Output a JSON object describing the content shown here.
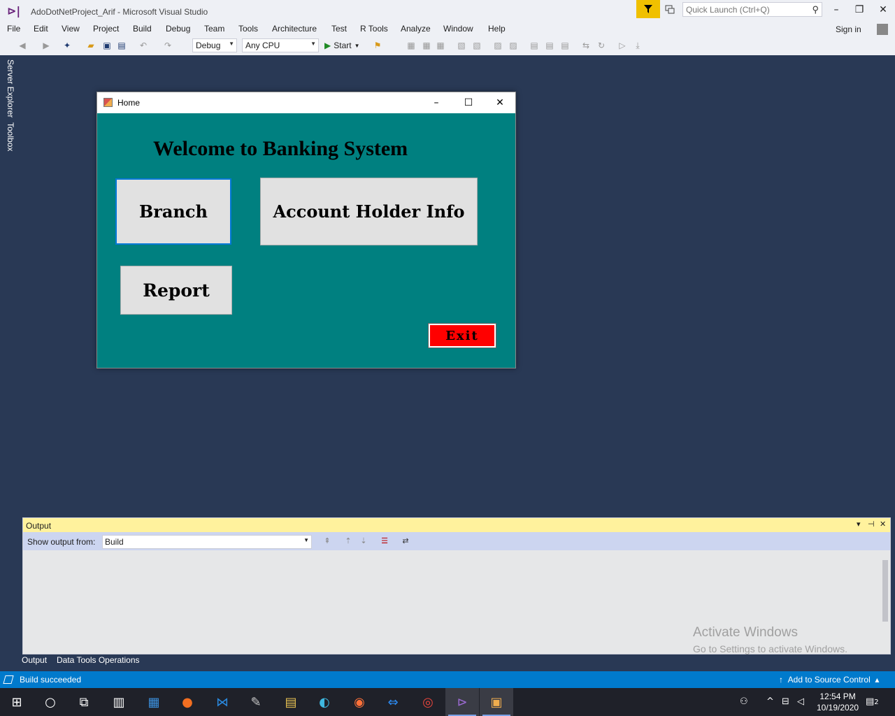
{
  "window": {
    "title": "AdoDotNetProject_Arif - Microsoft Visual Studio",
    "quick_launch_placeholder": "Quick Launch (Ctrl+Q)",
    "sign_in": "Sign in"
  },
  "menu": [
    "File",
    "Edit",
    "View",
    "Project",
    "Build",
    "Debug",
    "Team",
    "Tools",
    "Architecture",
    "Test",
    "R Tools",
    "Analyze",
    "Window",
    "Help"
  ],
  "toolbar": {
    "config": "Debug",
    "platform": "Any CPU",
    "start_label": "Start"
  },
  "side_tabs": [
    "Server Explorer",
    "Toolbox"
  ],
  "form": {
    "title": "Home",
    "welcome": "Welcome to Banking System",
    "branch": "Branch",
    "account_holder": "Account Holder Info",
    "report": "Report",
    "exit": "Exit",
    "colors": {
      "background": "#008080",
      "exit_bg": "#ff0000"
    }
  },
  "output": {
    "title": "Output",
    "show_from_label": "Show output from:",
    "show_from_value": "Build",
    "watermark_line1": "Activate Windows",
    "watermark_line2": "Go to Settings to activate Windows."
  },
  "bottom_tabs": [
    "Output",
    "Data Tools Operations"
  ],
  "status": {
    "text": "Build succeeded",
    "source_control": "Add to Source Control"
  },
  "taskbar": {
    "time": "12:54 PM",
    "date": "10/19/2020",
    "notification_count": "2"
  },
  "colors": {
    "accent": "#007acc",
    "ide_background": "#293955",
    "output_header": "#fff29d"
  }
}
